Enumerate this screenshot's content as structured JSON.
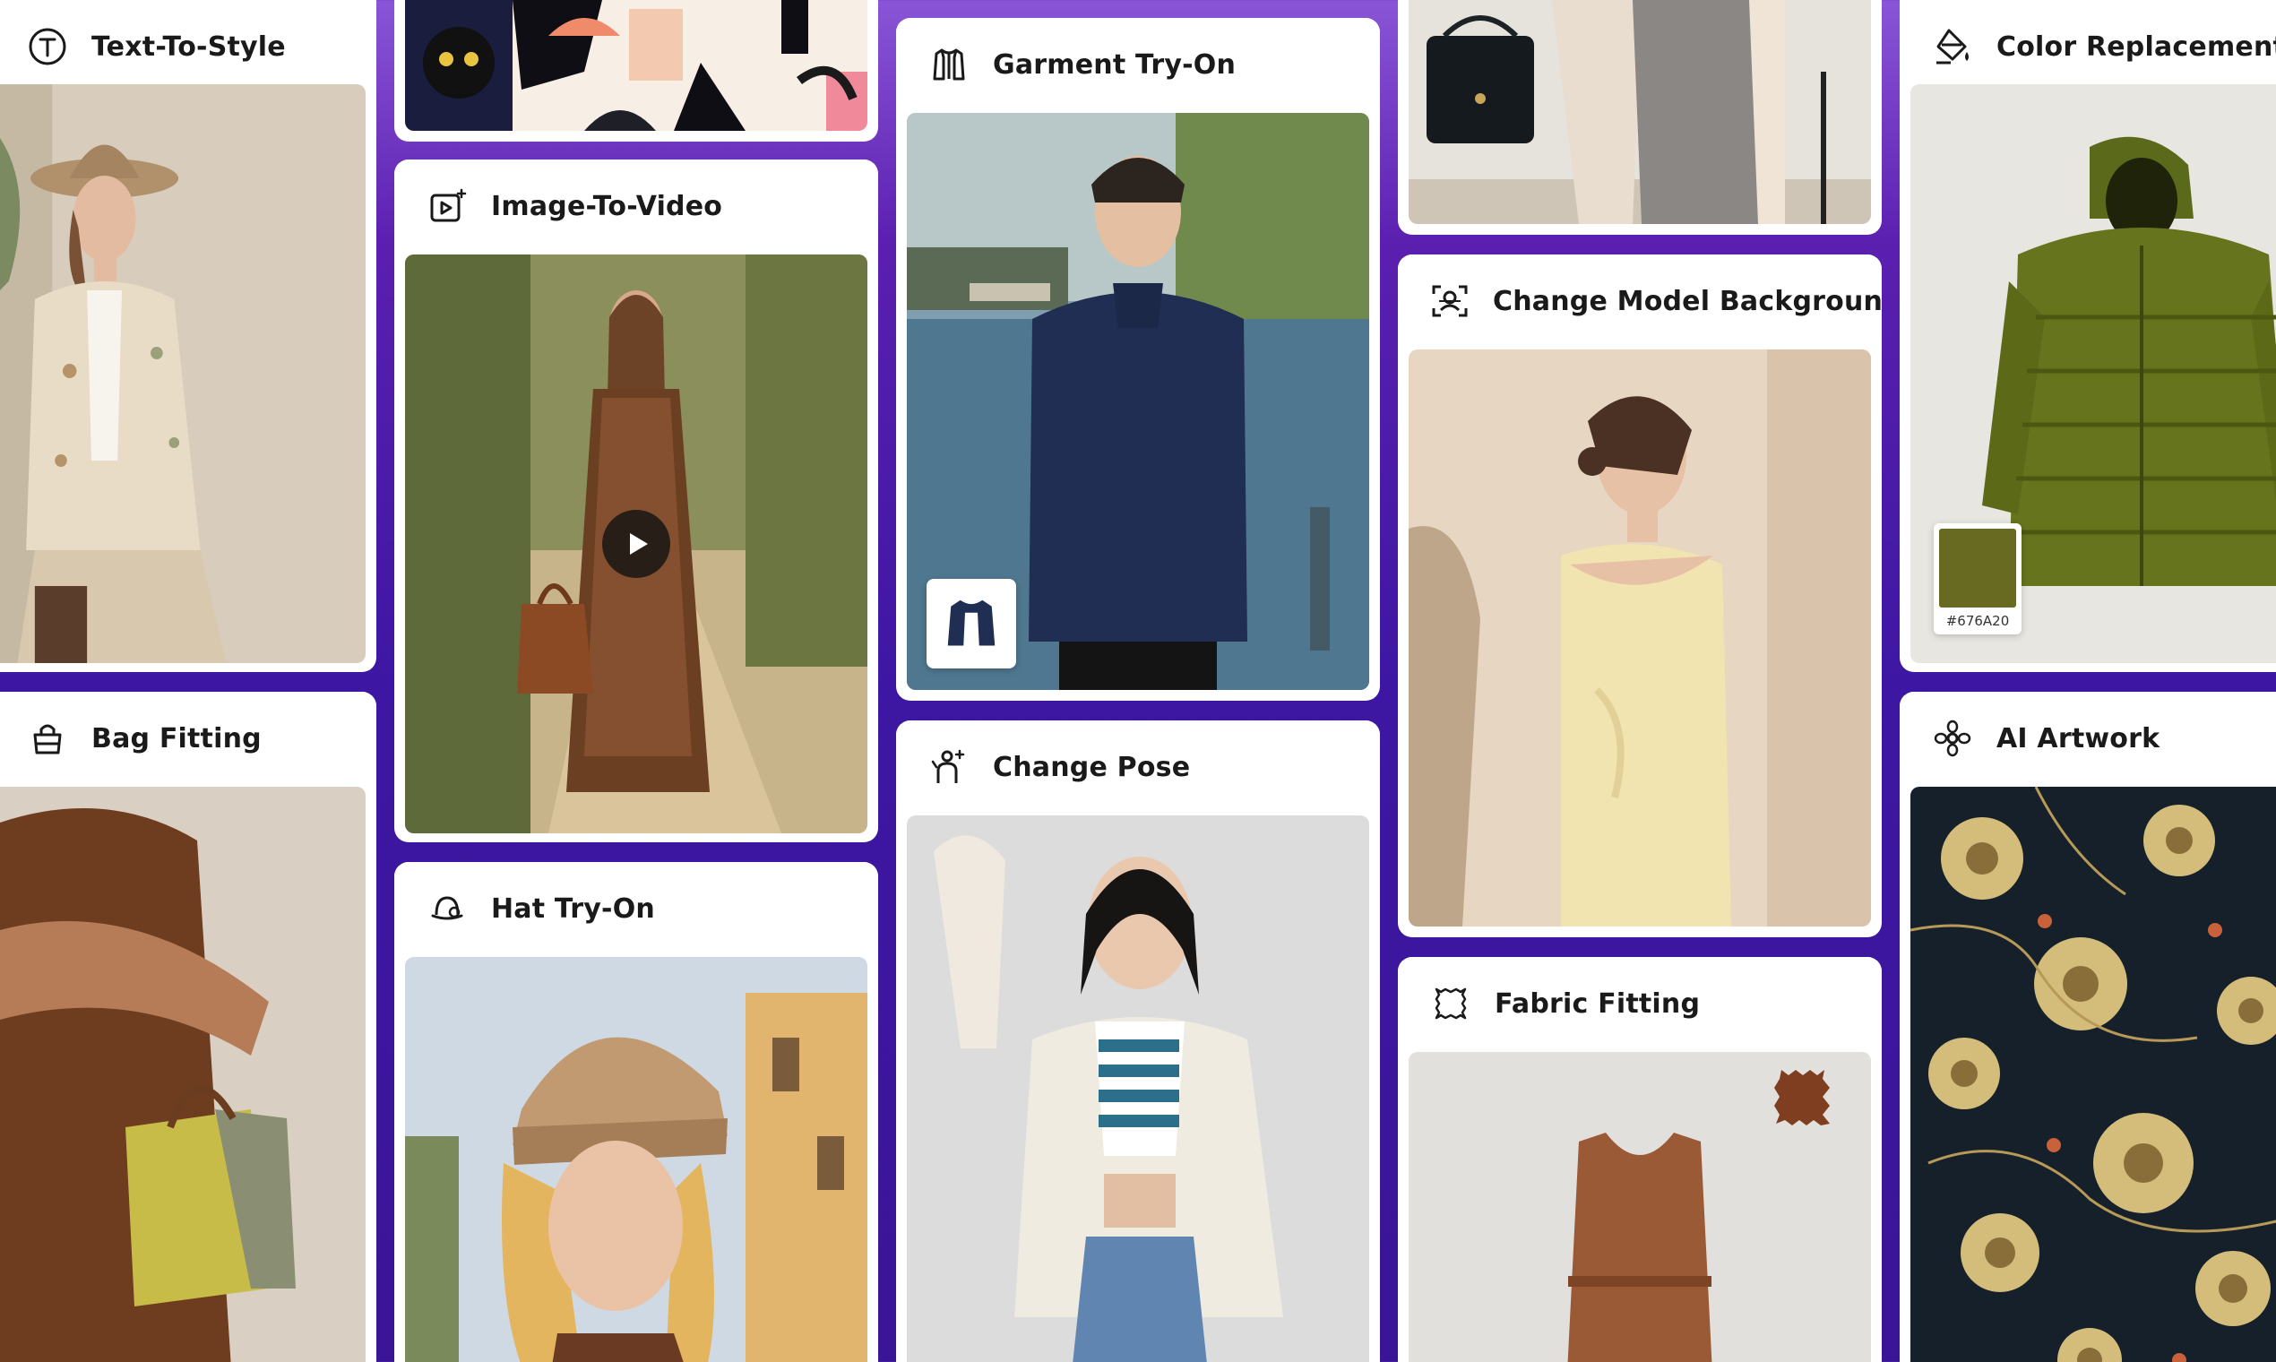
{
  "cards": {
    "text_to_style": {
      "title": "Text-To-Style",
      "icon": "text-circle-icon"
    },
    "bag_fitting": {
      "title": "Bag Fitting",
      "icon": "bag-icon"
    },
    "image_to_video": {
      "title": "Image-To-Video",
      "icon": "video-sparkle-icon"
    },
    "hat_try_on": {
      "title": "Hat Try-On",
      "icon": "hat-icon"
    },
    "garment_try_on": {
      "title": "Garment Try-On",
      "icon": "jacket-icon"
    },
    "change_pose": {
      "title": "Change Pose",
      "icon": "person-sparkle-icon"
    },
    "change_model_background": {
      "title": "Change Model Background",
      "icon": "background-scan-icon"
    },
    "fabric_fitting": {
      "title": "Fabric Fitting",
      "icon": "fabric-swatch-icon"
    },
    "color_replacement": {
      "title": "Color Replacement",
      "icon": "paint-bucket-icon"
    },
    "ai_artwork": {
      "title": "AI Artwork",
      "icon": "flower-pattern-icon"
    }
  },
  "color_swatch": {
    "hex": "#676A20",
    "label": "#676A20"
  },
  "colors": {
    "background_top": "#8A55D6",
    "background_main": "#3D17A3",
    "card": "#FFFFFF",
    "title_text": "#1A1A1A"
  }
}
